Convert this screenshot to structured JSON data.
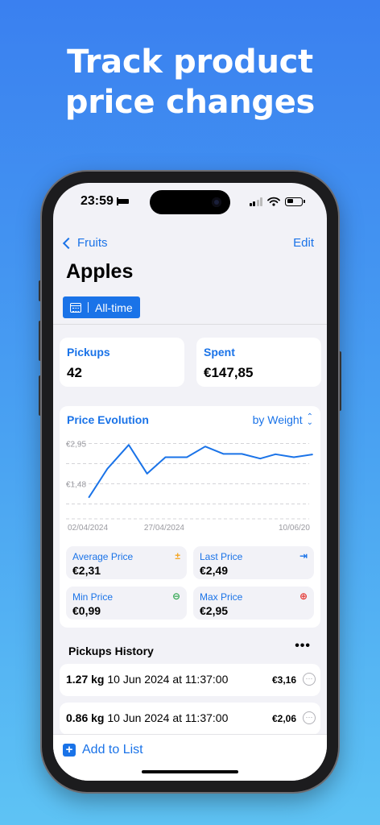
{
  "headline": {
    "line1": "Track product",
    "line2": "price changes"
  },
  "status_bar": {
    "time": "23:59"
  },
  "nav": {
    "back_label": "Fruits",
    "edit_label": "Edit"
  },
  "page": {
    "title": "Apples",
    "range_label": "All-time"
  },
  "stats": {
    "pickups": {
      "label": "Pickups",
      "value": "42"
    },
    "spent": {
      "label": "Spent",
      "value": "€147,85"
    }
  },
  "chart_section": {
    "title": "Price Evolution",
    "mode_label": "by Weight"
  },
  "chart_data": {
    "type": "line",
    "title": "",
    "xlabel": "",
    "ylabel": "",
    "y_ticks": [
      {
        "value": 2.95,
        "label": "€2,95"
      },
      {
        "value": 1.48,
        "label": "€1,48"
      }
    ],
    "x_ticks": [
      {
        "date": "2024-04-02",
        "label": "02/04/2024"
      },
      {
        "date": "2024-04-27",
        "label": "27/04/2024"
      },
      {
        "date": "2024-06-10",
        "label": "10/06/20"
      }
    ],
    "ylim": [
      0.2,
      3.2
    ],
    "grid": true,
    "series": [
      {
        "points": [
          {
            "date": "2024-04-09",
            "y": 0.99
          },
          {
            "date": "2024-04-15",
            "y": 2.03
          },
          {
            "date": "2024-04-22",
            "y": 2.9
          },
          {
            "date": "2024-04-28",
            "y": 1.85
          },
          {
            "date": "2024-05-04",
            "y": 2.45
          },
          {
            "date": "2024-05-11",
            "y": 2.45
          },
          {
            "date": "2024-05-17",
            "y": 2.84
          },
          {
            "date": "2024-05-23",
            "y": 2.57
          },
          {
            "date": "2024-05-29",
            "y": 2.57
          },
          {
            "date": "2024-06-04",
            "y": 2.4
          },
          {
            "date": "2024-06-09",
            "y": 2.56
          },
          {
            "date": "2024-06-15",
            "y": 2.45
          },
          {
            "date": "2024-06-21",
            "y": 2.55
          }
        ]
      }
    ]
  },
  "metrics": {
    "average": {
      "label": "Average Price",
      "value": "€2,31",
      "icon": "average-icon",
      "color": "#f5a623"
    },
    "last": {
      "label": "Last Price",
      "value": "€2,49",
      "icon": "arrow-to-right-icon",
      "color": "#1a73e8"
    },
    "min": {
      "label": "Min Price",
      "value": "€0,99",
      "icon": "minus-circle-icon",
      "color": "#34a853"
    },
    "max": {
      "label": "Max Price",
      "value": "€2,95",
      "icon": "plus-circle-icon",
      "color": "#e53935"
    }
  },
  "history": {
    "title": "Pickups History",
    "items": [
      {
        "weight": "1.27 kg",
        "datetime": "10 Jun 2024 at 11:37:00",
        "price": "€3,16"
      },
      {
        "weight": "0.86 kg",
        "datetime": "10 Jun 2024 at 11:37:00",
        "price": "€2,06"
      }
    ]
  },
  "bottom": {
    "add_label": "Add to List"
  },
  "colors": {
    "accent": "#1a73e8",
    "background_top": "#3a80f0",
    "background_bottom": "#5ec3f4"
  }
}
